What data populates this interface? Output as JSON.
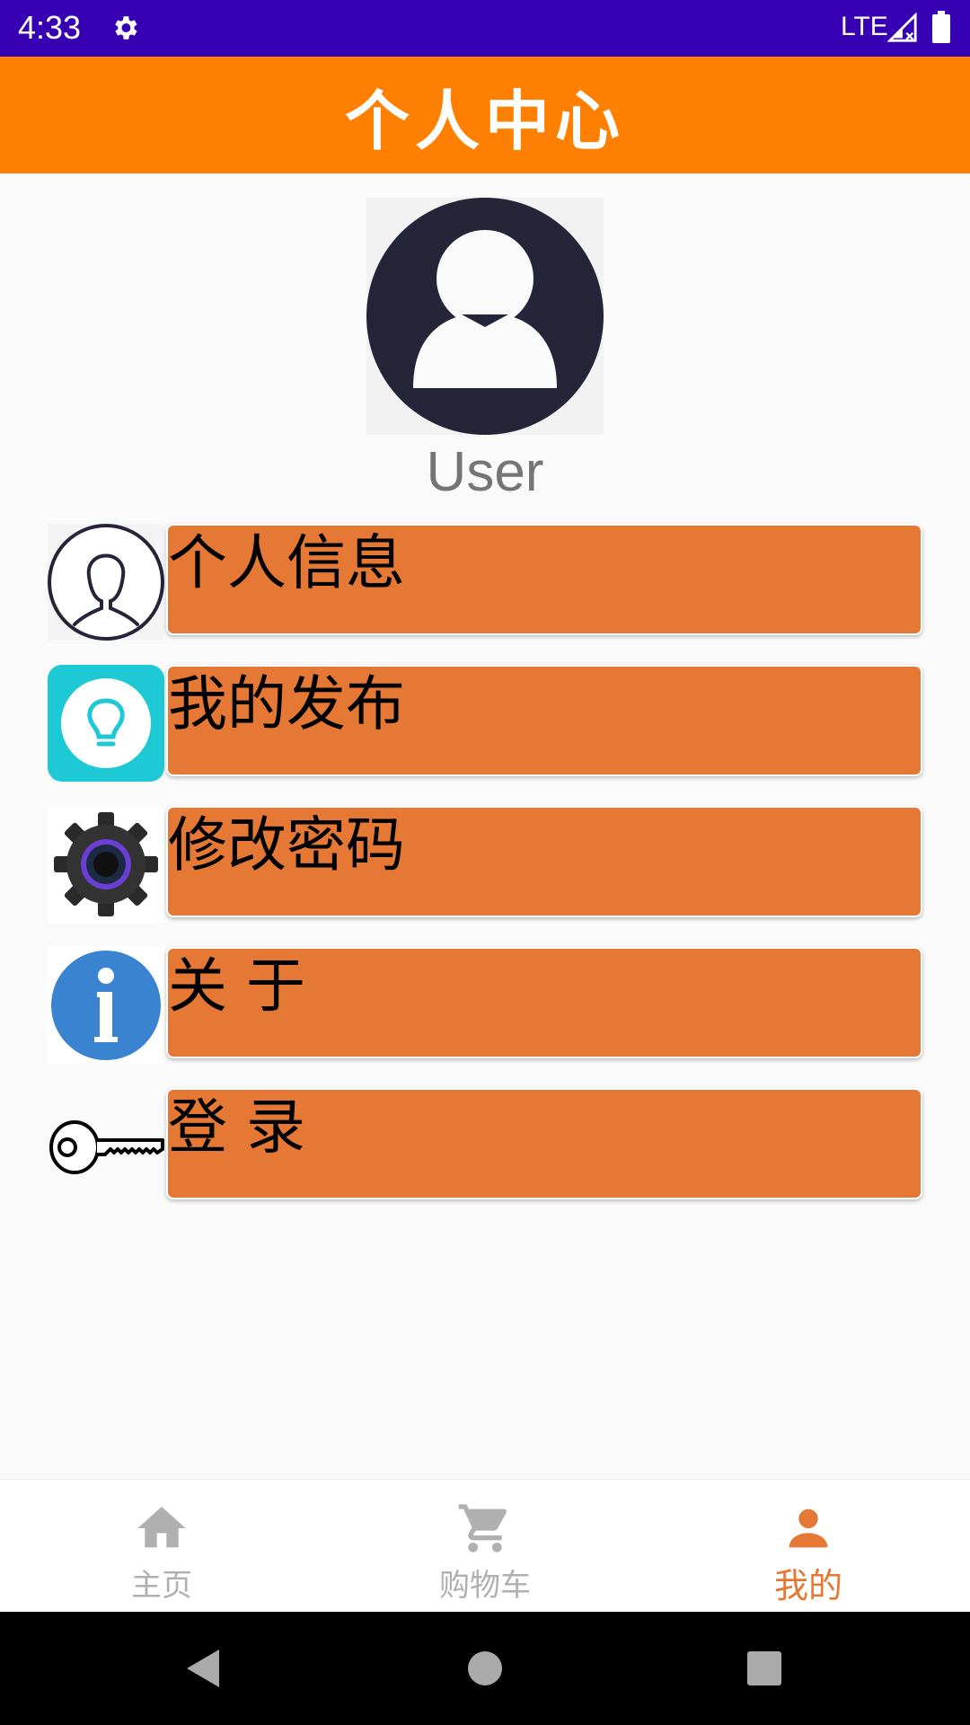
{
  "status_bar": {
    "time": "4:33",
    "network": "LTE",
    "icons": [
      "gear-icon",
      "signal-icon",
      "battery-icon"
    ]
  },
  "app_bar": {
    "title": "个人中心",
    "color": "#ff8000"
  },
  "profile": {
    "username": "User",
    "avatar_icon": "user-avatar-icon"
  },
  "menu": {
    "button_color": "#e47834",
    "items": [
      {
        "label": "个人信息",
        "icon": "person-outline-icon"
      },
      {
        "label": "我的发布",
        "icon": "lightbulb-icon"
      },
      {
        "label": "修改密码",
        "icon": "gear-icon"
      },
      {
        "label": "关 于",
        "icon": "info-icon"
      },
      {
        "label": "登 录",
        "icon": "key-icon"
      }
    ]
  },
  "bottom_nav": {
    "active_color": "#e47834",
    "items": [
      {
        "label": "主页",
        "icon": "home-icon",
        "active": false
      },
      {
        "label": "购物车",
        "icon": "cart-icon",
        "active": false
      },
      {
        "label": "我的",
        "icon": "person-icon",
        "active": true
      }
    ]
  },
  "system_nav": {
    "icons": [
      "back-icon",
      "home-circle-icon",
      "recents-icon"
    ]
  }
}
